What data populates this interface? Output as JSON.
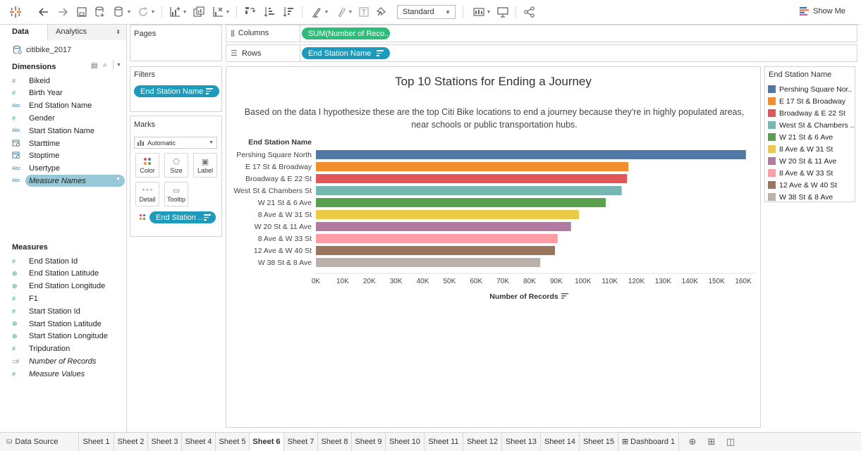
{
  "toolbar": {
    "view_mode": "Standard",
    "show_me": "Show Me"
  },
  "datapane": {
    "tab_data": "Data",
    "tab_analytics": "Analytics",
    "datasource": "citibike_2017",
    "dimensions_title": "Dimensions",
    "dimensions": [
      {
        "icon": "#",
        "label": "Bikeid"
      },
      {
        "icon": "#",
        "label": "Birth Year"
      },
      {
        "icon": "Abc",
        "label": "End Station Name"
      },
      {
        "icon": "#",
        "label": "Gender"
      },
      {
        "icon": "Abc",
        "label": "Start Station Name"
      },
      {
        "icon": "cal",
        "label": "Starttime"
      },
      {
        "icon": "cal",
        "label": "Stoptime"
      },
      {
        "icon": "Abc",
        "label": "Usertype"
      },
      {
        "icon": "Abc",
        "label": "Measure Names"
      }
    ],
    "measures_title": "Measures",
    "measures": [
      {
        "icon": "#",
        "label": "End Station Id"
      },
      {
        "icon": "globe",
        "label": "End Station Latitude"
      },
      {
        "icon": "globe",
        "label": "End Station Longitude"
      },
      {
        "icon": "#",
        "label": "F1"
      },
      {
        "icon": "#",
        "label": "Start Station Id"
      },
      {
        "icon": "globe",
        "label": "Start Station Latitude"
      },
      {
        "icon": "globe",
        "label": "Start Station Longitude"
      },
      {
        "icon": "#",
        "label": "Tripduration"
      },
      {
        "icon": "=#",
        "label": "Number of Records"
      },
      {
        "icon": "#",
        "label": "Measure Values"
      }
    ]
  },
  "shelves": {
    "pages": "Pages",
    "filters": "Filters",
    "filter_pill": "End Station Name",
    "marks": "Marks",
    "marks_type": "Automatic",
    "mark_buttons": [
      "Color",
      "Size",
      "Label",
      "Detail",
      "Tooltip"
    ],
    "marks_pill": "End Station ..",
    "columns_label": "Columns",
    "columns_pill": "SUM(Number of Reco..",
    "rows_label": "Rows",
    "rows_pill": "End Station Name"
  },
  "chart": {
    "title": "Top 10 Stations for Ending a Journey",
    "subtitle": "Based on the data I hypothesize these are the top Citi Bike locations to end a journey because they're in highly populated areas, near schools or public transportation hubs."
  },
  "chart_data": {
    "type": "bar",
    "orientation": "horizontal",
    "title": "Top 10 Stations for Ending a Journey",
    "row_header": "End Station Name",
    "xlabel": "Number of Records",
    "xlim": [
      0,
      160000
    ],
    "xticks": [
      "0K",
      "10K",
      "20K",
      "30K",
      "40K",
      "50K",
      "60K",
      "70K",
      "80K",
      "90K",
      "100K",
      "110K",
      "120K",
      "130K",
      "140K",
      "150K",
      "160K"
    ],
    "categories": [
      "Pershing Square North",
      "E 17 St & Broadway",
      "Broadway & E 22 St",
      "West St & Chambers St",
      "W 21 St & 6 Ave",
      "8 Ave & W 31 St",
      "W 20 St & 11 Ave",
      "8 Ave & W 33 St",
      "12 Ave & W 40 St",
      "W 38 St & 8 Ave"
    ],
    "values": [
      161000,
      117000,
      116500,
      114500,
      108500,
      98500,
      95500,
      90500,
      89500,
      84000
    ],
    "colors": [
      "#4e79a7",
      "#f28e2b",
      "#e15759",
      "#76b7b2",
      "#59a14f",
      "#edc948",
      "#b07aa1",
      "#ff9da7",
      "#9c755f",
      "#bab0ac"
    ],
    "grid": false,
    "legend": "right"
  },
  "legend": {
    "title": "End Station Name",
    "items": [
      "Pershing Square Nor..",
      "E 17 St & Broadway",
      "Broadway & E 22 St",
      "West St & Chambers ..",
      "W 21 St & 6 Ave",
      "8 Ave & W 31 St",
      "W 20 St & 11 Ave",
      "8 Ave & W 33 St",
      "12 Ave & W 40 St",
      "W 38 St & 8 Ave"
    ]
  },
  "tabs": {
    "data_source": "Data Source",
    "sheets": [
      "Sheet 1",
      "Sheet 2",
      "Sheet 3",
      "Sheet 4",
      "Sheet 5",
      "Sheet 6",
      "Sheet 7",
      "Sheet 8",
      "Sheet 9",
      "Sheet 10",
      "Sheet 11",
      "Sheet 12",
      "Sheet 13",
      "Sheet 14",
      "Sheet 15"
    ],
    "active": "Sheet 6",
    "dashboard": "Dashboard 1"
  }
}
